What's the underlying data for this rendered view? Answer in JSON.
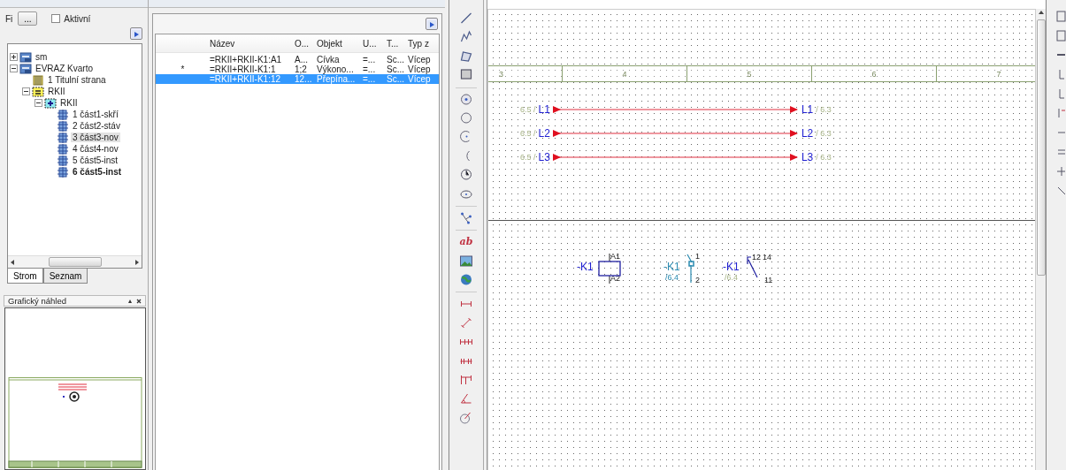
{
  "tree_panel": {
    "filter_label": "Fi",
    "filter_button": "...",
    "active_checkbox": {
      "label": "Aktivní",
      "checked": false
    },
    "tree": [
      {
        "label": "sm",
        "kind": "project",
        "expanded": false
      },
      {
        "label": "EVRAZ Kvarto",
        "kind": "project",
        "expanded": true,
        "children": [
          {
            "label": "1 Titulní strana",
            "kind": "page"
          },
          {
            "label": "RKII",
            "kind": "function",
            "expanded": true,
            "children": [
              {
                "label": "RKII",
                "kind": "location",
                "expanded": true,
                "children": [
                  {
                    "label": "1 část1-skří",
                    "kind": "sheet",
                    "selected": false,
                    "current": false
                  },
                  {
                    "label": "2 část2-stáv",
                    "kind": "sheet",
                    "selected": false,
                    "current": false
                  },
                  {
                    "label": "3 část3-nov",
                    "kind": "sheet",
                    "selected": true,
                    "current": false
                  },
                  {
                    "label": "4 část4-nov",
                    "kind": "sheet",
                    "selected": false,
                    "current": false
                  },
                  {
                    "label": "5 část5-inst",
                    "kind": "sheet",
                    "selected": false,
                    "current": false
                  },
                  {
                    "label": "6 část5-inst",
                    "kind": "sheet",
                    "selected": false,
                    "current": true
                  }
                ]
              }
            ]
          }
        ]
      }
    ],
    "tabs": [
      {
        "label": "Strom",
        "selected": true
      },
      {
        "label": "Seznam",
        "selected": false
      }
    ],
    "preview": {
      "title": "Grafický náhled"
    }
  },
  "table": {
    "columns": [
      "Název",
      "O...",
      "Objekt",
      "U...",
      "T...",
      "Typ z"
    ],
    "rows": [
      {
        "cells": [
          "=RKII+RKII-K1:A1",
          "A...",
          "Cívka",
          "=...",
          "Sc...",
          "Vícep"
        ],
        "selected": false
      },
      {
        "marker": "*",
        "cells": [
          "=RKII+RKII-K1:1",
          "1;2",
          "Výkono...",
          "=...",
          "Sc...",
          "Vícep"
        ],
        "selected": false
      },
      {
        "cells": [
          "=RKII+RKII-K1:12",
          "12...",
          "Přepína...",
          "=...",
          "Sc...",
          "Vícep"
        ],
        "selected": true
      }
    ]
  },
  "toolbar": {
    "text_tool": "ab"
  },
  "sheet": {
    "ruler": [
      "3",
      "4",
      "5",
      "6",
      "7"
    ],
    "signals": [
      {
        "ref_left": "6.5 /",
        "name_left": "L1",
        "name_right": "L1",
        "ref_right": "/ 6.3"
      },
      {
        "ref_left": "6.5 /",
        "name_left": "L2",
        "name_right": "L2",
        "ref_right": "/ 6.3"
      },
      {
        "ref_left": "6.5 /",
        "name_left": "L3",
        "name_right": "L3",
        "ref_right": "/ 6.3"
      }
    ],
    "symbols": [
      {
        "kind": "coil",
        "label": "-K1",
        "pins": [
          "A1",
          "A2"
        ],
        "highlighted": false
      },
      {
        "kind": "contact",
        "label": "-K1",
        "ref": "/6.4",
        "pins": [
          "1",
          "2"
        ],
        "highlighted": true
      },
      {
        "kind": "changeover",
        "label": "-K1",
        "ref": "/6.4",
        "pins": [
          "12",
          "14",
          "11"
        ],
        "highlighted": false
      }
    ]
  }
}
